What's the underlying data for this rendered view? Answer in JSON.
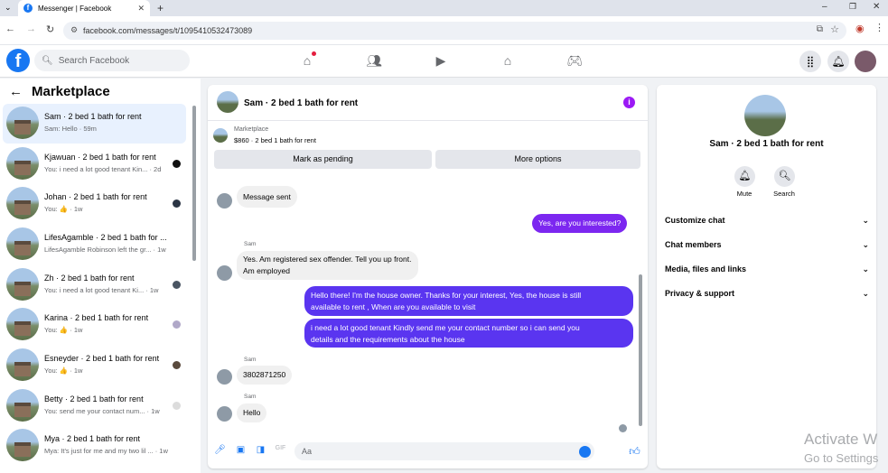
{
  "browser": {
    "tab_title": "Messenger | Facebook",
    "url": "facebook.com/messages/t/1095410532473089"
  },
  "header": {
    "search_placeholder": "Search Facebook",
    "brand_letter": "f",
    "brand_color": "#1877f2"
  },
  "left": {
    "title": "Marketplace",
    "conversations": [
      {
        "name": "Sam · 2 bed 1 bath for rent",
        "preview": "Sam: Hello · 59m",
        "active": true
      },
      {
        "name": "Kjawuan · 2 bed 1 bath for rent",
        "preview": "You: i need a lot good tenant Kin... · 2d"
      },
      {
        "name": "Johan · 2 bed 1 bath for rent",
        "preview": "You: 👍 · 1w"
      },
      {
        "name": "LifesAgamble · 2 bed 1 bath for ...",
        "preview": "LifesAgamble Robinson left the gr... · 1w"
      },
      {
        "name": "Zh · 2 bed 1 bath for rent",
        "preview": "You: i need a lot good tenant Ki...  · 1w"
      },
      {
        "name": "Karina · 2 bed 1 bath for rent",
        "preview": "You: 👍 · 1w"
      },
      {
        "name": "Esneyder · 2 bed 1 bath for rent",
        "preview": "You: 👍 · 1w"
      },
      {
        "name": "Betty · 2 bed 1 bath for rent",
        "preview": "You: send me your contact num... · 1w"
      },
      {
        "name": "Mya · 2 bed 1 bath for rent",
        "preview": "Mya: It's just for me and my two lil ... · 1w"
      }
    ]
  },
  "chat": {
    "title": "Sam · 2 bed 1 bath for rent",
    "marketplace_label": "Marketplace",
    "listing": "$860 · 2 bed 1 bath for rent",
    "btn_pending": "Mark as pending",
    "btn_more": "More options",
    "messages": {
      "m1": "Message sent",
      "m2": "Yes, are you interested?",
      "sender": "Sam",
      "m3_line1": "Yes.  Am registered sex offender. Tell you up front.",
      "m3_line2": "Am employed",
      "m4_line1": "Hello there! I'm the house owner. Thanks for your interest, Yes, the house is still",
      "m4_line2": "available to rent , When are you available to visit",
      "m5_line1": "i need a lot good tenant Kindly send me your contact number so i can send you",
      "m5_line2": "details and the requirements about the house",
      "m6": "3802871250",
      "m7": "Hello"
    },
    "composer_placeholder": "Aa"
  },
  "right": {
    "title": "Sam · 2 bed 1 bath for rent",
    "mute_label": "Mute",
    "search_label": "Search",
    "rows": [
      "Customize chat",
      "Chat members",
      "Media, files and links",
      "Privacy & support"
    ]
  },
  "watermark": {
    "line1": "Activate W",
    "line2": "Go to Settings"
  }
}
